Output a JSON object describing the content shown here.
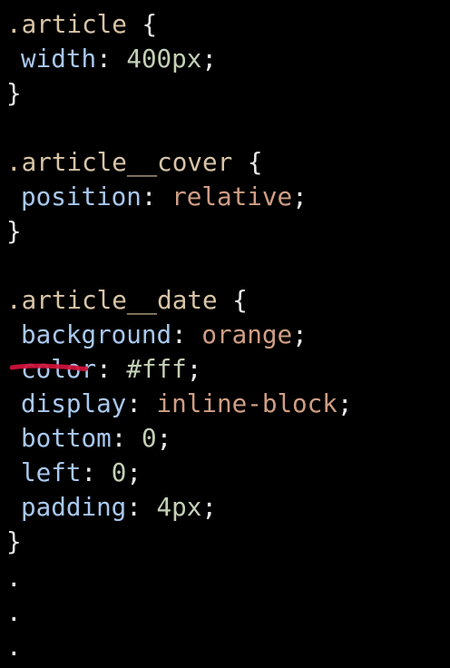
{
  "editor": {
    "rules": [
      {
        "selector": ".article",
        "open": " {",
        "decls": [
          {
            "prop": "width",
            "value": "400px",
            "value_kind": "num"
          }
        ],
        "close": "}"
      },
      {
        "selector": ".article__cover",
        "open": " {",
        "decls": [
          {
            "prop": "position",
            "value": "relative",
            "value_kind": "kw"
          }
        ],
        "close": "}"
      },
      {
        "selector": ".article__date",
        "open": " {",
        "decls": [
          {
            "prop": "background",
            "value": "orange",
            "value_kind": "kw"
          },
          {
            "prop": "color",
            "value": "#fff",
            "value_kind": "num",
            "struck": true
          },
          {
            "prop": "display",
            "value": "inline-block",
            "value_kind": "kw"
          },
          {
            "prop": "bottom",
            "value": "0",
            "value_kind": "num"
          },
          {
            "prop": "left",
            "value": "0",
            "value_kind": "num"
          },
          {
            "prop": "padding",
            "value": "4px",
            "value_kind": "num"
          }
        ],
        "close": "}"
      }
    ],
    "trailing_dots": [
      ".",
      ".",
      "."
    ],
    "colon": ":",
    "semicolon": ";",
    "colors": {
      "background": "#000000",
      "selector": "#d8c4a6",
      "property": "#a9c8ee",
      "keyword_value": "#d09e84",
      "numeric_value": "#c3d0b6",
      "punctuation": "#e8e8e8",
      "strike_mark": "#d3143c"
    }
  }
}
